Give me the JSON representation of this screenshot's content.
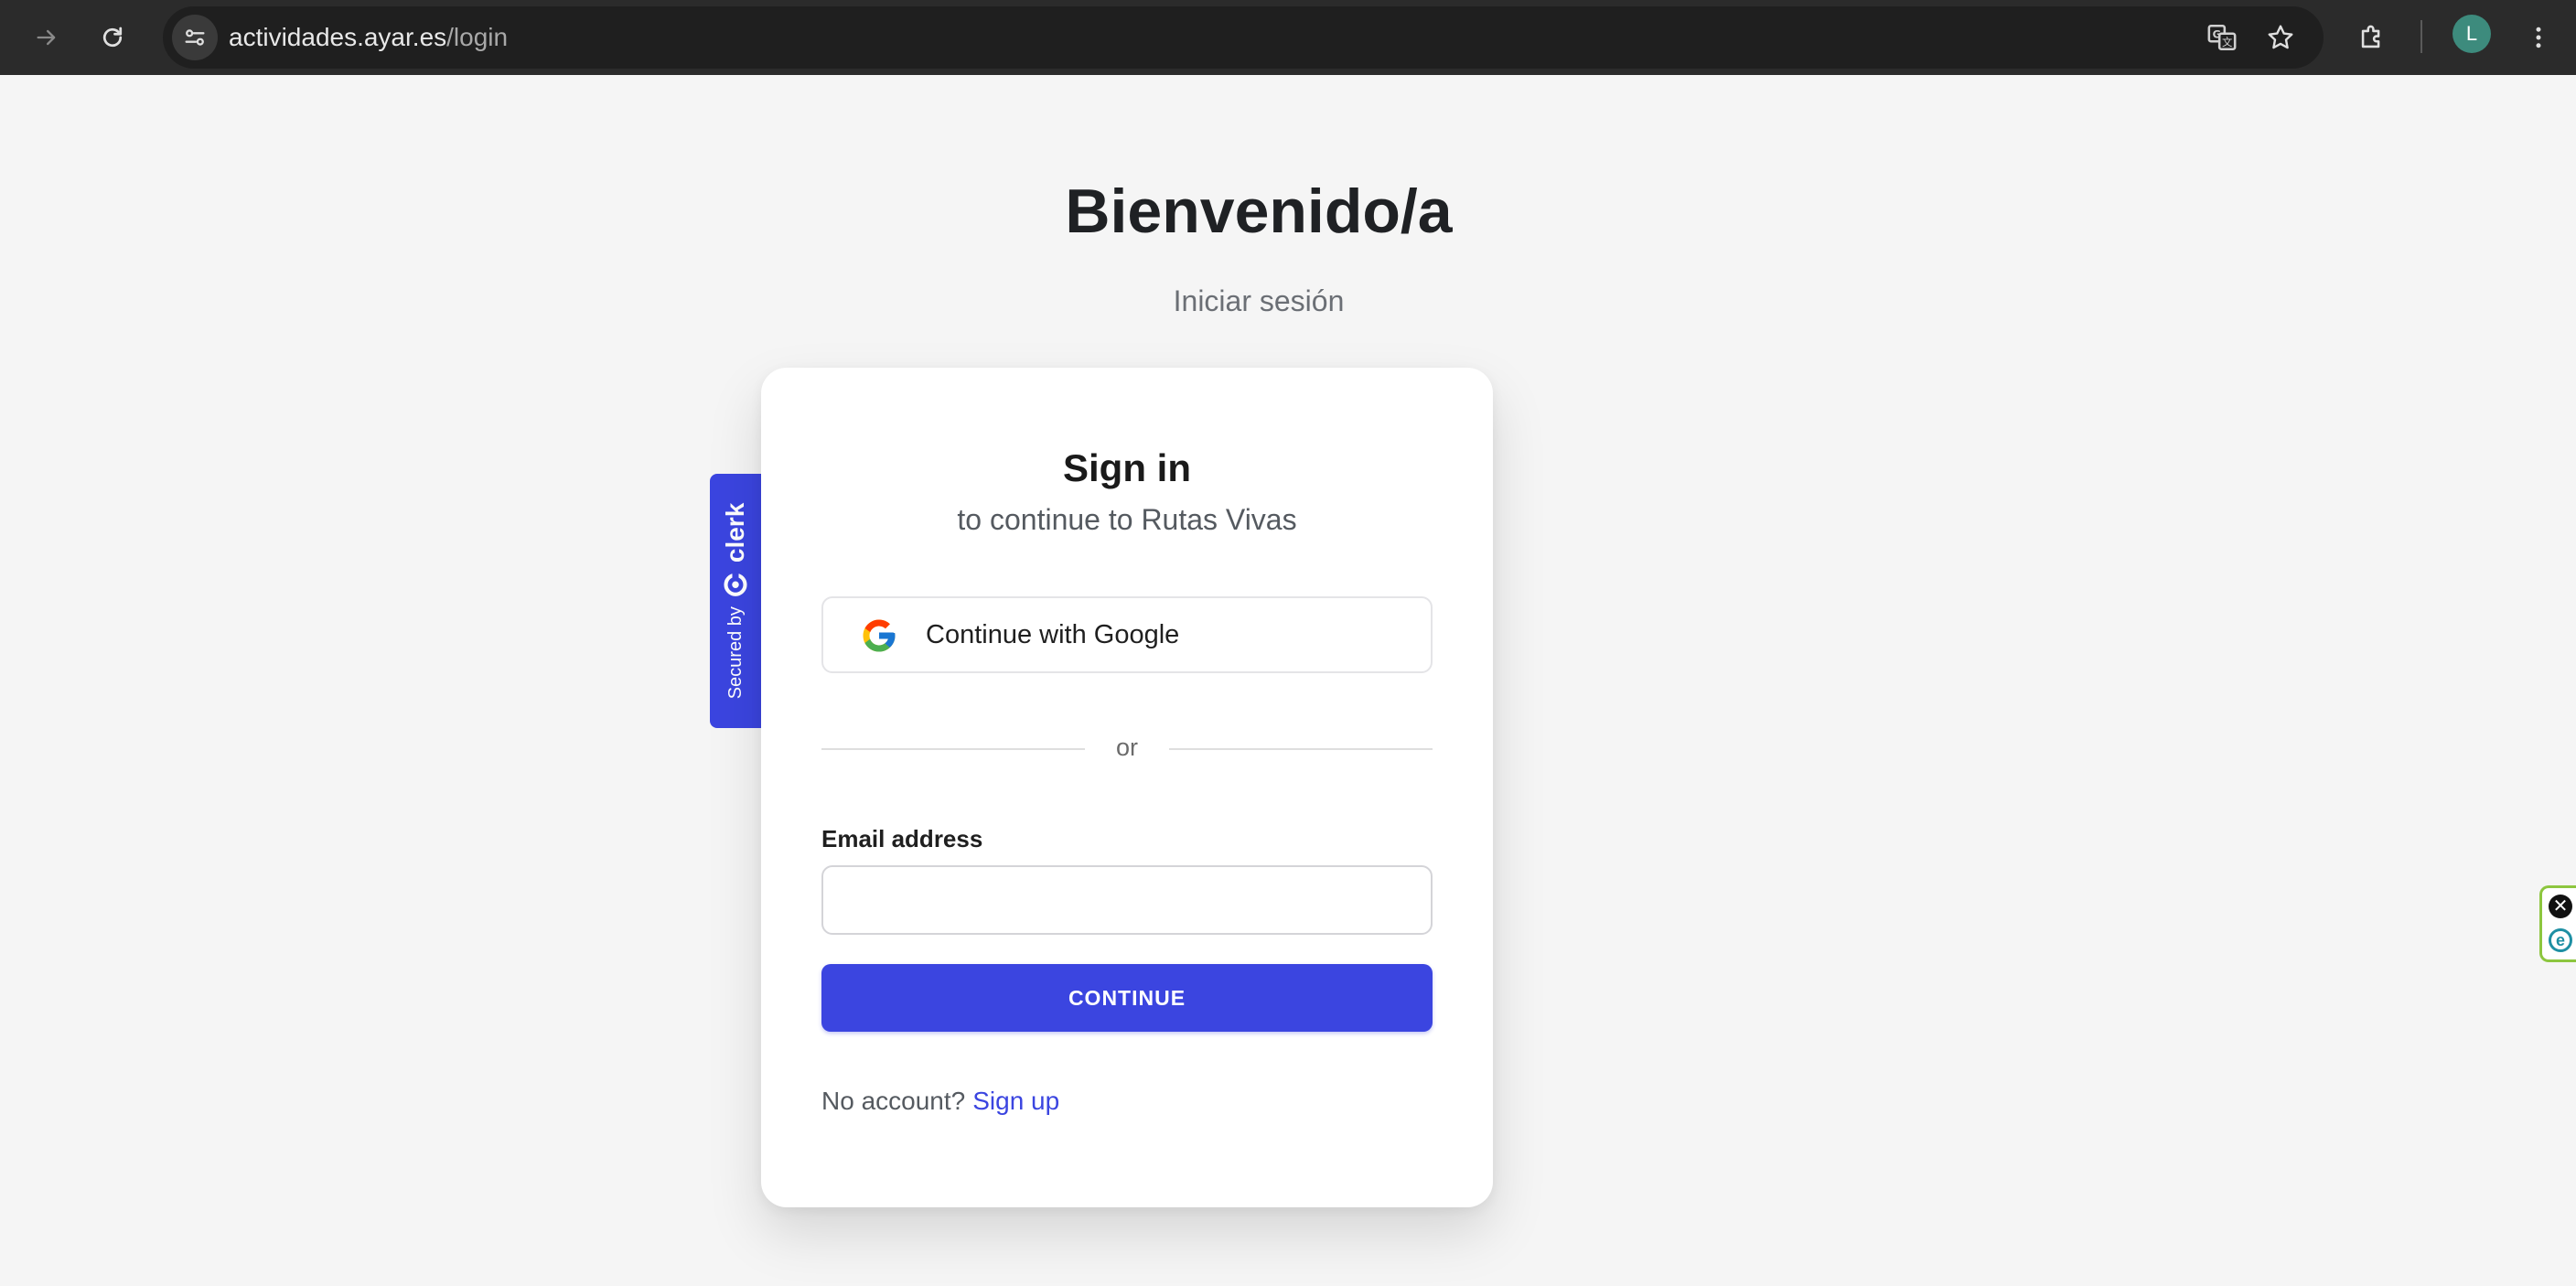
{
  "browser": {
    "url_host": "actividades.ayar.es",
    "url_path": "/login",
    "profile_initial": "L",
    "icons": [
      "forward-icon",
      "reload-icon",
      "site-settings-icon",
      "translate-icon",
      "bookmark-star-icon",
      "extensions-icon",
      "menu-kebab-icon"
    ]
  },
  "page": {
    "title": "Bienvenido/a",
    "subtitle": "Iniciar sesión"
  },
  "clerk_badge": {
    "secured_by": "Secured by",
    "brand": "clerk"
  },
  "signin_card": {
    "title": "Sign in",
    "subtitle": "to continue to Rutas Vivas",
    "google_label": "Continue with Google",
    "divider": "or",
    "email_label": "Email address",
    "email_value": "",
    "email_placeholder": "",
    "continue_label": "CONTINUE",
    "no_account": "No account?",
    "signup_label": "Sign up"
  },
  "extension_widget": {
    "close_glyph": "✕",
    "logo_letter": "e"
  },
  "colors": {
    "accent": "#3b45e0",
    "page_bg": "#f5f5f5",
    "chrome_bg": "#2b2b2b",
    "avatar_bg": "#3d8b7d"
  }
}
